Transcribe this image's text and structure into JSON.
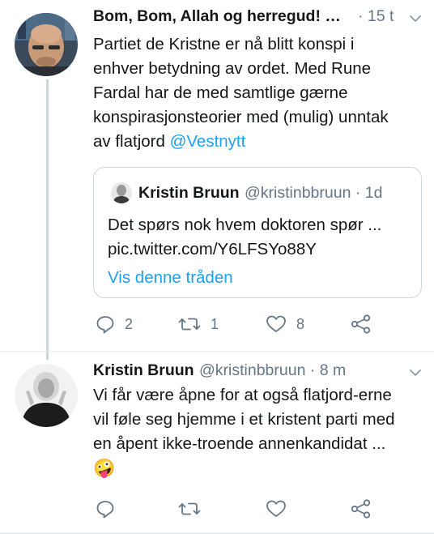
{
  "tweet1": {
    "display_name": "Bom, Bom, Allah og herregud! …",
    "time": "· 15 t",
    "lines": [
      "Partiet de Kristne er nå blitt konspi i",
      "enhver betydning av ordet. Med Rune",
      "Fardal har de med samtlige gærne",
      "konspirasjonsteorier med (mulig) unntak"
    ],
    "last_line_text": "av flatjord ",
    "mention": "@Vestnytt",
    "quote": {
      "display_name": "Kristin Bruun",
      "handle": "@kristinbbruun · 1d",
      "text_line1": "Det spørs nok hvem doktoren spør ...",
      "text_line2": "pic.twitter.com/Y6LFSYo88Y",
      "show_thread": "Vis denne tråden"
    },
    "actions": {
      "replies": "2",
      "retweets": "1",
      "likes": "8"
    }
  },
  "tweet2": {
    "display_name": "Kristin Bruun",
    "handle": "@kristinbbruun · 8 m",
    "lines": [
      "Vi får være åpne for at også flatjord-erne",
      "vil føle seg hjemme i et kristent parti med",
      "en åpent ikke-troende annenkandidat ..."
    ],
    "emoji": "🤪"
  },
  "icons": [
    "chevron-down-icon",
    "reply-icon",
    "retweet-icon",
    "like-icon",
    "share-icon"
  ],
  "colors": {
    "link": "#1da1f2",
    "secondary_text": "#657786",
    "border": "#ccd6dd"
  }
}
